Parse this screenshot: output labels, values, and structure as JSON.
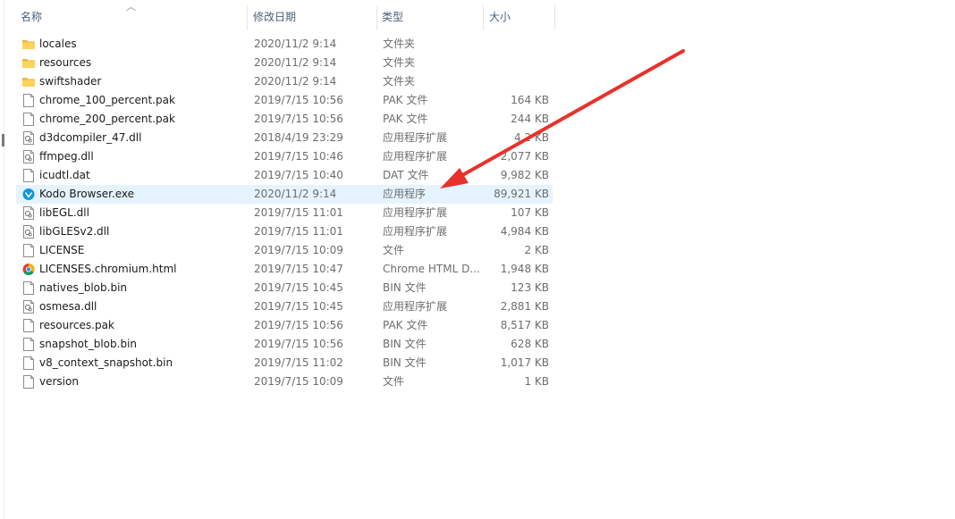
{
  "header": {
    "name": "名称",
    "date": "修改日期",
    "type": "类型",
    "size": "大小",
    "sort_indicator": "chevron-up-icon"
  },
  "colors": {
    "selected_row": "#e5f3ff",
    "header_text": "#4c607a",
    "folder_yellow": "#ffd25b",
    "arrow_red": "#e8312a"
  },
  "files": [
    {
      "name": "locales",
      "date": "2020/11/2 9:14",
      "type": "文件夹",
      "size": "",
      "icon": "folder-icon"
    },
    {
      "name": "resources",
      "date": "2020/11/2 9:14",
      "type": "文件夹",
      "size": "",
      "icon": "folder-icon"
    },
    {
      "name": "swiftshader",
      "date": "2020/11/2 9:14",
      "type": "文件夹",
      "size": "",
      "icon": "folder-icon"
    },
    {
      "name": "chrome_100_percent.pak",
      "date": "2019/7/15 10:56",
      "type": "PAK 文件",
      "size": "164 KB",
      "icon": "file-icon"
    },
    {
      "name": "chrome_200_percent.pak",
      "date": "2019/7/15 10:56",
      "type": "PAK 文件",
      "size": "244 KB",
      "icon": "file-icon"
    },
    {
      "name": "d3dcompiler_47.dll",
      "date": "2018/4/19 23:29",
      "type": "应用程序扩展",
      "size": "4,2   KB",
      "icon": "dll-icon"
    },
    {
      "name": "ffmpeg.dll",
      "date": "2019/7/15 10:46",
      "type": "应用程序扩展",
      "size": "2,077 KB",
      "icon": "dll-icon"
    },
    {
      "name": "icudtl.dat",
      "date": "2019/7/15 10:40",
      "type": "DAT 文件",
      "size": "9,982 KB",
      "icon": "file-icon"
    },
    {
      "name": "Kodo Browser.exe",
      "date": "2020/11/2 9:14",
      "type": "应用程序",
      "size": "89,921 KB",
      "icon": "kodo-app-icon",
      "selected": true
    },
    {
      "name": "libEGL.dll",
      "date": "2019/7/15 11:01",
      "type": "应用程序扩展",
      "size": "107 KB",
      "icon": "dll-icon"
    },
    {
      "name": "libGLESv2.dll",
      "date": "2019/7/15 11:01",
      "type": "应用程序扩展",
      "size": "4,984 KB",
      "icon": "dll-icon"
    },
    {
      "name": "LICENSE",
      "date": "2019/7/15 10:09",
      "type": "文件",
      "size": "2 KB",
      "icon": "file-icon"
    },
    {
      "name": "LICENSES.chromium.html",
      "date": "2019/7/15 10:47",
      "type": "Chrome HTML D...",
      "size": "1,948 KB",
      "icon": "chrome-icon"
    },
    {
      "name": "natives_blob.bin",
      "date": "2019/7/15 10:45",
      "type": "BIN 文件",
      "size": "123 KB",
      "icon": "file-icon"
    },
    {
      "name": "osmesa.dll",
      "date": "2019/7/15 10:45",
      "type": "应用程序扩展",
      "size": "2,881 KB",
      "icon": "dll-icon"
    },
    {
      "name": "resources.pak",
      "date": "2019/7/15 10:56",
      "type": "PAK 文件",
      "size": "8,517 KB",
      "icon": "file-icon"
    },
    {
      "name": "snapshot_blob.bin",
      "date": "2019/7/15 10:56",
      "type": "BIN 文件",
      "size": "628 KB",
      "icon": "file-icon"
    },
    {
      "name": "v8_context_snapshot.bin",
      "date": "2019/7/15 11:02",
      "type": "BIN 文件",
      "size": "1,017 KB",
      "icon": "file-icon"
    },
    {
      "name": "version",
      "date": "2019/7/15 10:09",
      "type": "文件",
      "size": "1 KB",
      "icon": "file-icon"
    }
  ],
  "annotation": {
    "type": "arrow",
    "color": "#e8312a",
    "points_to": "Kodo Browser.exe"
  }
}
